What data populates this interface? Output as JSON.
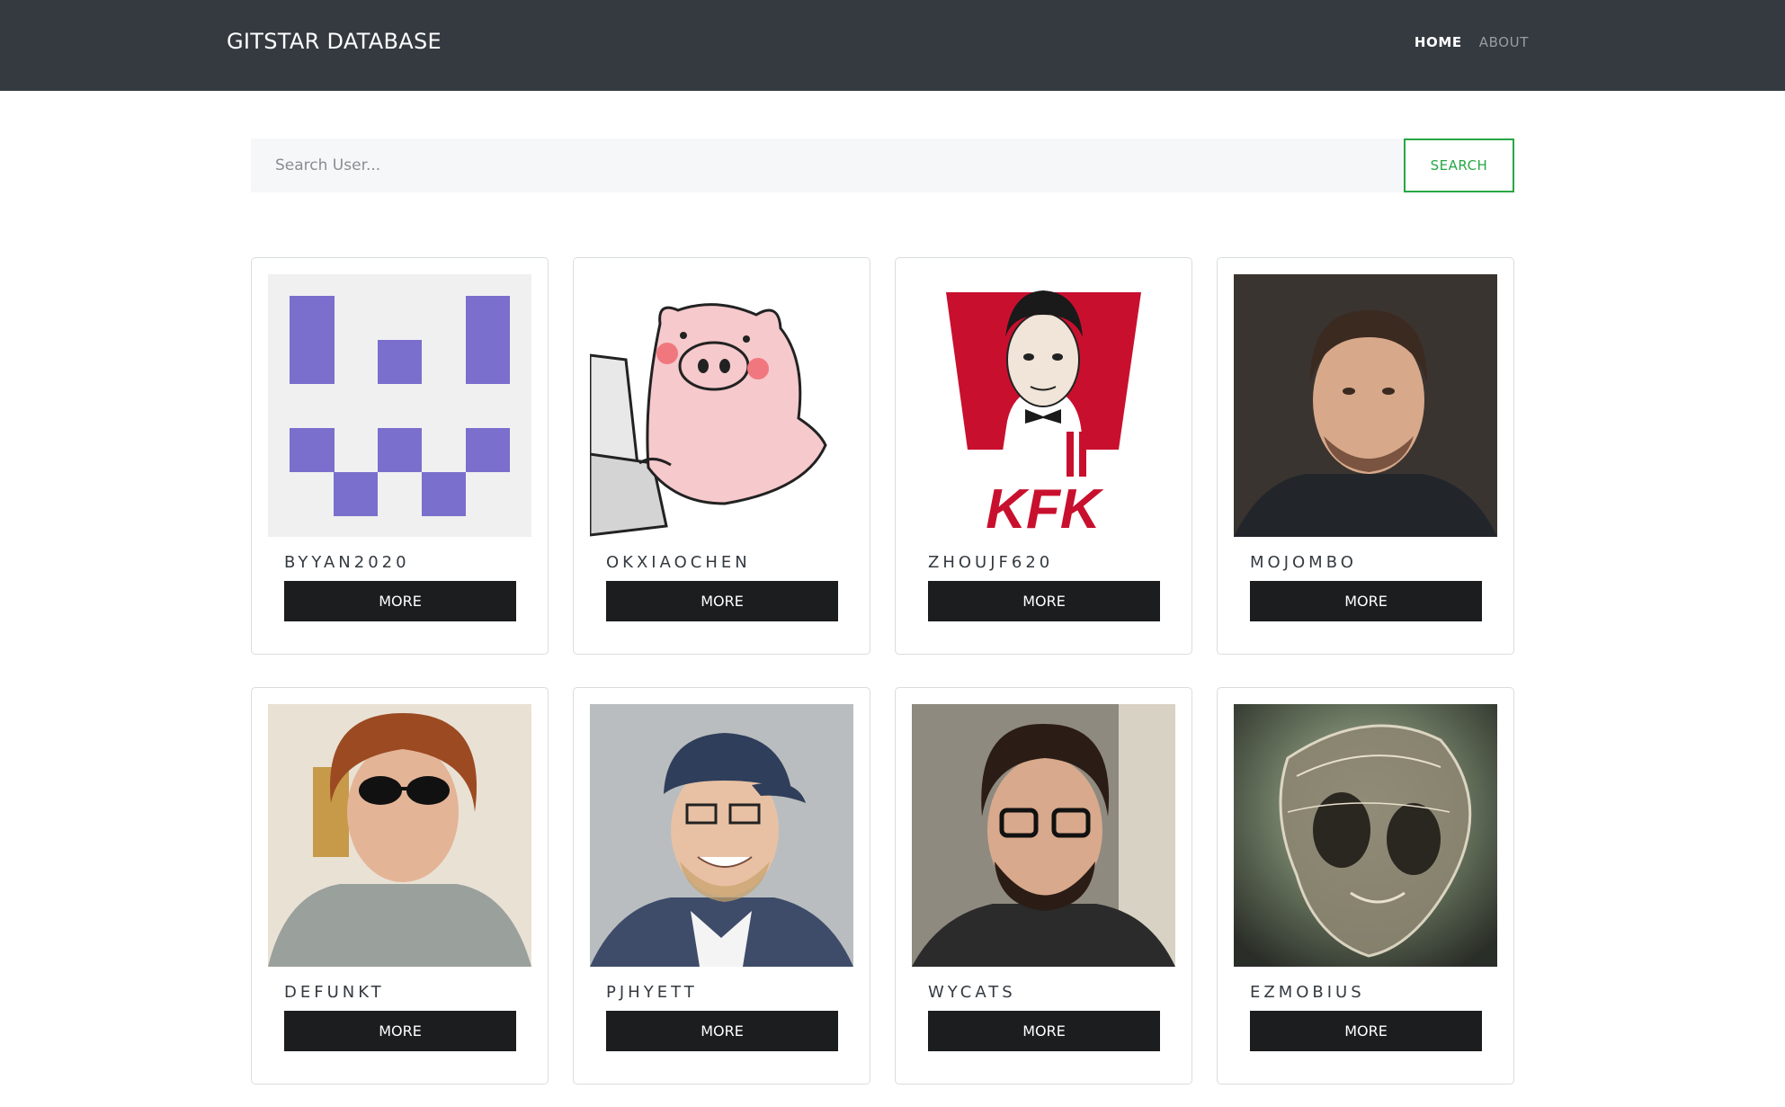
{
  "navbar": {
    "brand": "GITSTAR DATABASE",
    "links": [
      {
        "label": "HOME"
      },
      {
        "label": "ABOUT"
      }
    ]
  },
  "search": {
    "placeholder": "Search User...",
    "value": "",
    "button_label": "SEARCH"
  },
  "users": [
    {
      "username": "BYYAN2020",
      "button": "MORE"
    },
    {
      "username": "OKXIAOCHEN",
      "button": "MORE"
    },
    {
      "username": "ZHOUJF620",
      "button": "MORE"
    },
    {
      "username": "MOJOMBO",
      "button": "MORE"
    },
    {
      "username": "DEFUNKT",
      "button": "MORE"
    },
    {
      "username": "PJHYETT",
      "button": "MORE"
    },
    {
      "username": "WYCATS",
      "button": "MORE"
    },
    {
      "username": "EZMOBIUS",
      "button": "MORE"
    }
  ],
  "kfk_logo_text": "KFK",
  "colors": {
    "navbar": "#343a40",
    "search_accent": "#28a745",
    "more_button": "#1b1d1f",
    "identicon": "#7a6fcc"
  }
}
